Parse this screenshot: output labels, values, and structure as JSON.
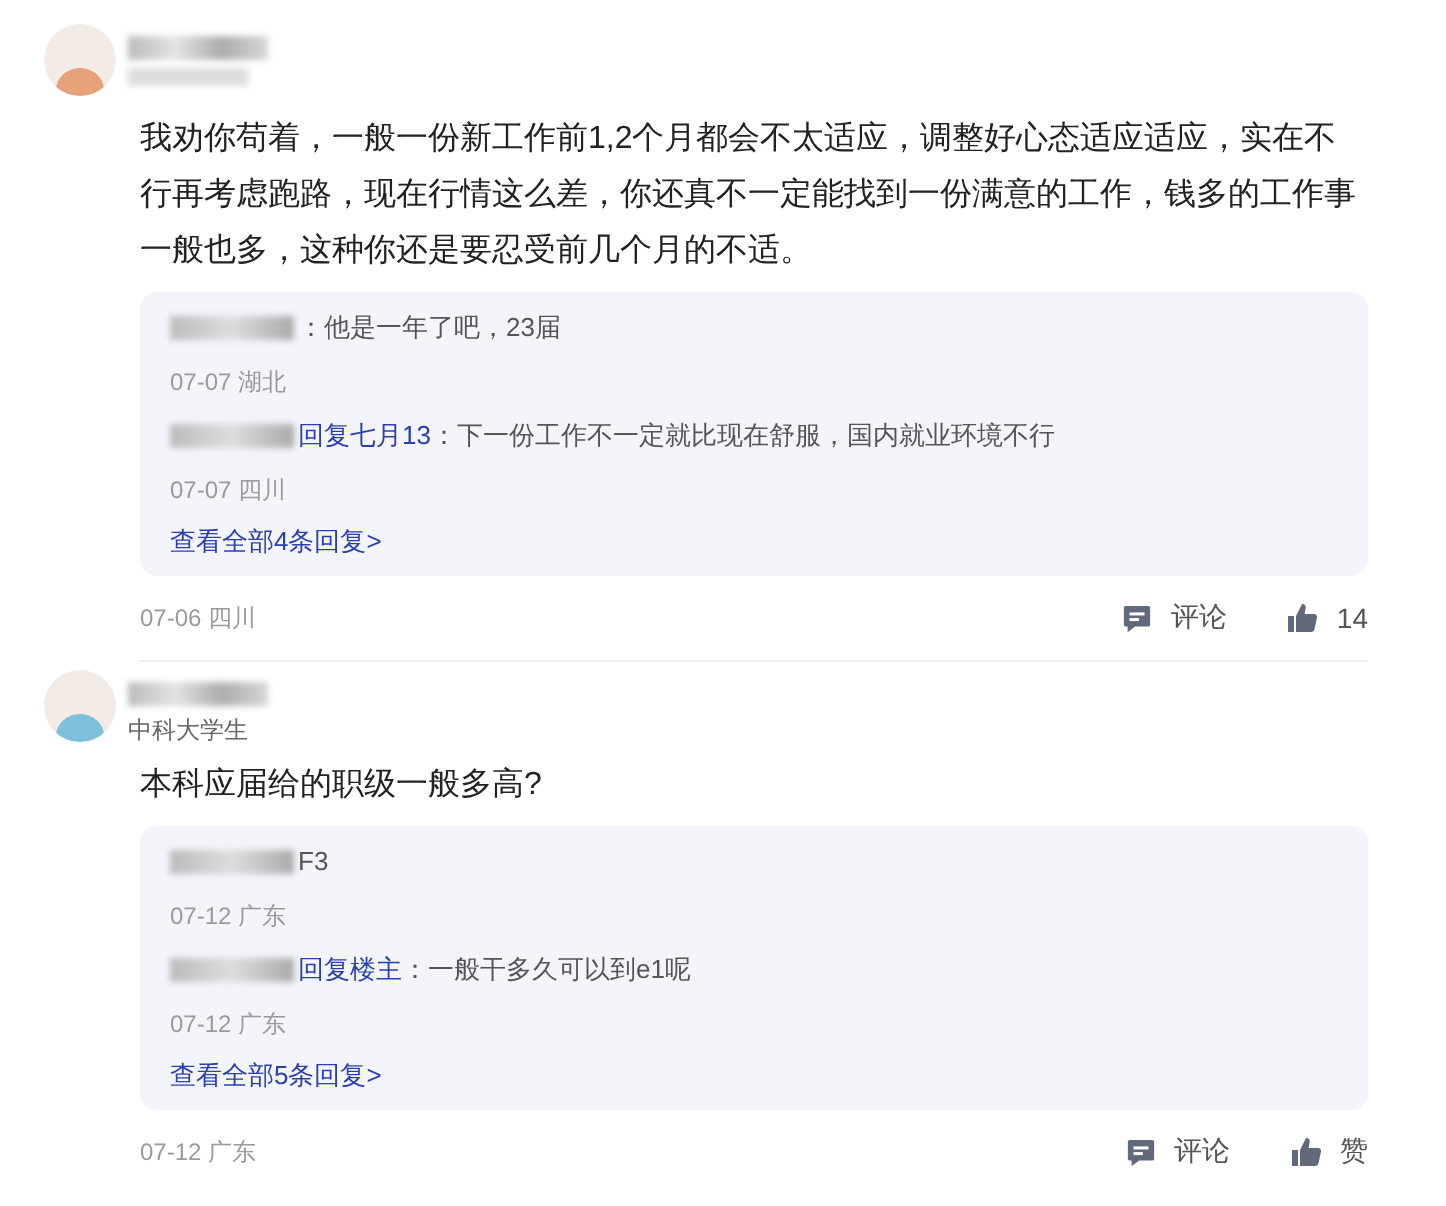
{
  "comments": [
    {
      "avatar": {
        "color": "#e8a27a"
      },
      "content": "我劝你苟着，一般一份新工作前1,2个月都会不太适应，调整好心态适应适应，实在不行再考虑跑路，现在行情这么差，你还真不一定能找到一份满意的工作，钱多的工作事一般也多，这种你还是要忍受前几个月的不适。",
      "replies": [
        {
          "text": "：他是一年了吧，23届",
          "date": "07-07 湖北"
        },
        {
          "reply_to": "回复七月13",
          "text": "：下一份工作不一定就比现在舒服，国内就业环境不行",
          "date": "07-07 四川"
        }
      ],
      "more_link": "查看全部4条回复>",
      "date": "07-06 四川",
      "actions": [
        {
          "kind": "comment",
          "label": "评论"
        },
        {
          "kind": "like",
          "label": "14"
        }
      ]
    },
    {
      "avatar": {
        "color": "#7cc0dc"
      },
      "subtitle": "中科大学生",
      "content": "本科应届给的职级一般多高?",
      "replies": [
        {
          "text": "F3",
          "date": "07-12 广东"
        },
        {
          "reply_to": "回复楼主",
          "text": "：一般干多久可以到e1呢",
          "date": "07-12 广东"
        }
      ],
      "more_link": "查看全部5条回复>",
      "date": "07-12 广东",
      "actions": [
        {
          "kind": "comment",
          "label": "评论"
        },
        {
          "kind": "like",
          "label": "赞"
        }
      ]
    }
  ]
}
